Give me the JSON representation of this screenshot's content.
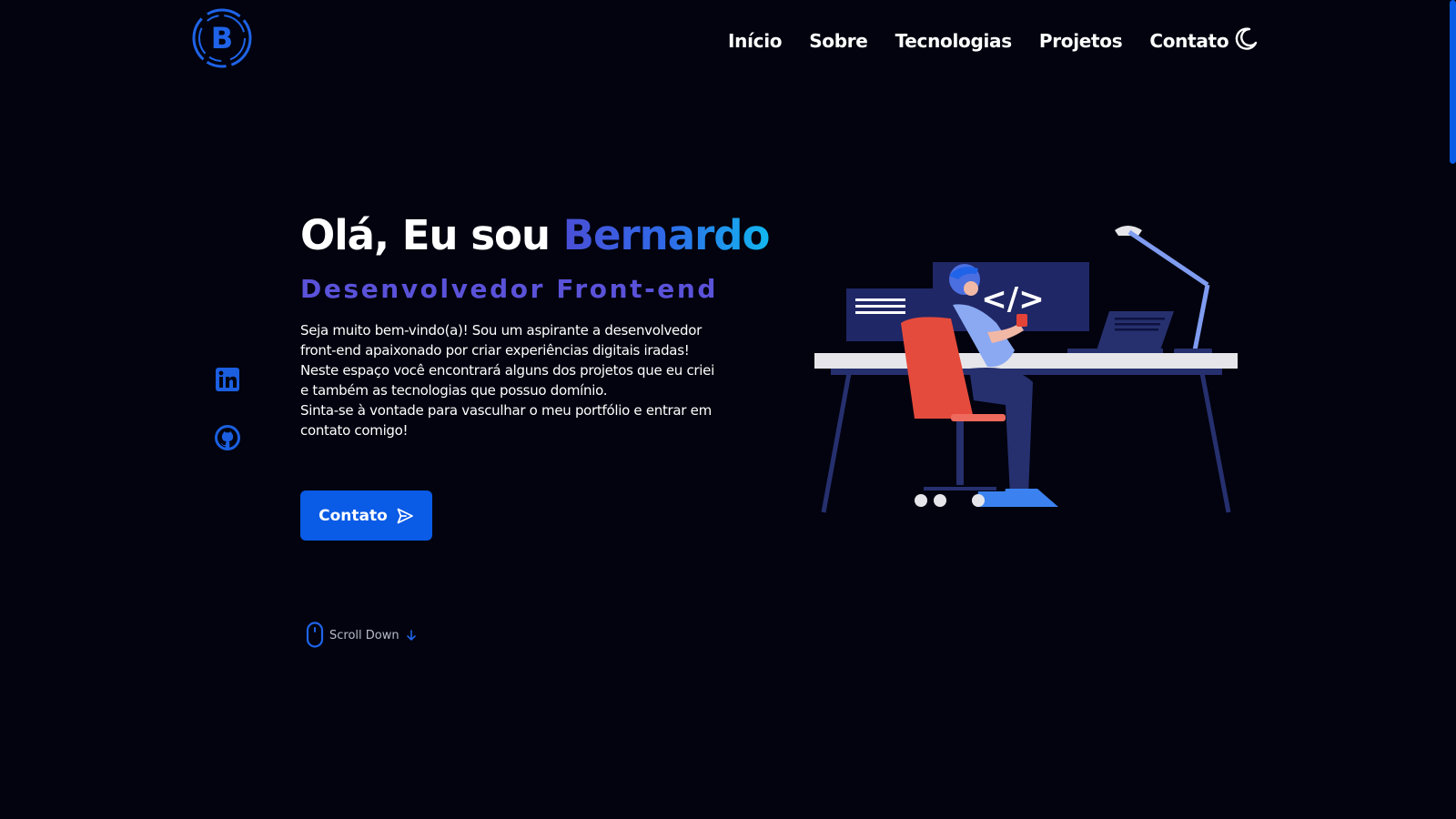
{
  "header": {
    "logo_letter": "B",
    "nav": [
      "Início",
      "Sobre",
      "Tecnologias",
      "Projetos",
      "Contato"
    ],
    "theme_icon": "moon-icon"
  },
  "social": {
    "linkedin_icon": "linkedin-icon",
    "github_icon": "github-icon"
  },
  "hero": {
    "greeting": "Olá, Eu sou ",
    "name": "Bernardo",
    "subtitle": "Desenvolvedor Front-end",
    "paragraphs": [
      "Seja muito bem-vindo(a)! Sou um aspirante a desenvolvedor front-end apaixonado por criar experiências digitais iradas!",
      "Neste espaço você encontrará alguns dos projetos que eu criei e também as tecnologias que possuo domínio.",
      "Sinta-se à vontade para vasculhar o meu portfólio e entrar em contato comigo!"
    ],
    "contact_button": "Contato",
    "scroll_label": "Scroll Down",
    "code_symbol": "</>"
  },
  "colors": {
    "background": "#02030f",
    "accent": "#0a5be6",
    "subtitle": "#5a52d9"
  }
}
